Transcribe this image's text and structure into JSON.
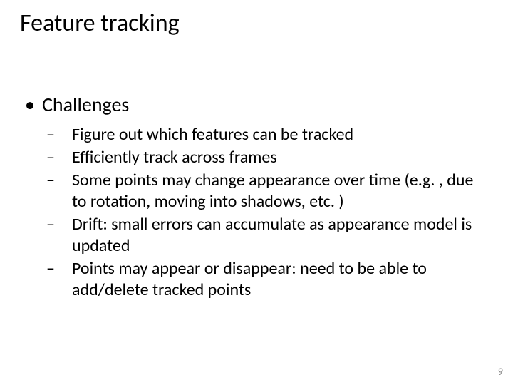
{
  "title": "Feature tracking",
  "bullet1": {
    "label": "Challenges",
    "items": [
      "Figure out which features can be tracked",
      "Efficiently track across frames",
      "Some points may change appearance over time (e.g. , due to rotation, moving into shadows, etc. )",
      "Drift: small errors can accumulate as appearance model is updated",
      "Points may appear or disappear: need to be able to add/delete tracked points"
    ]
  },
  "page_number": "9"
}
